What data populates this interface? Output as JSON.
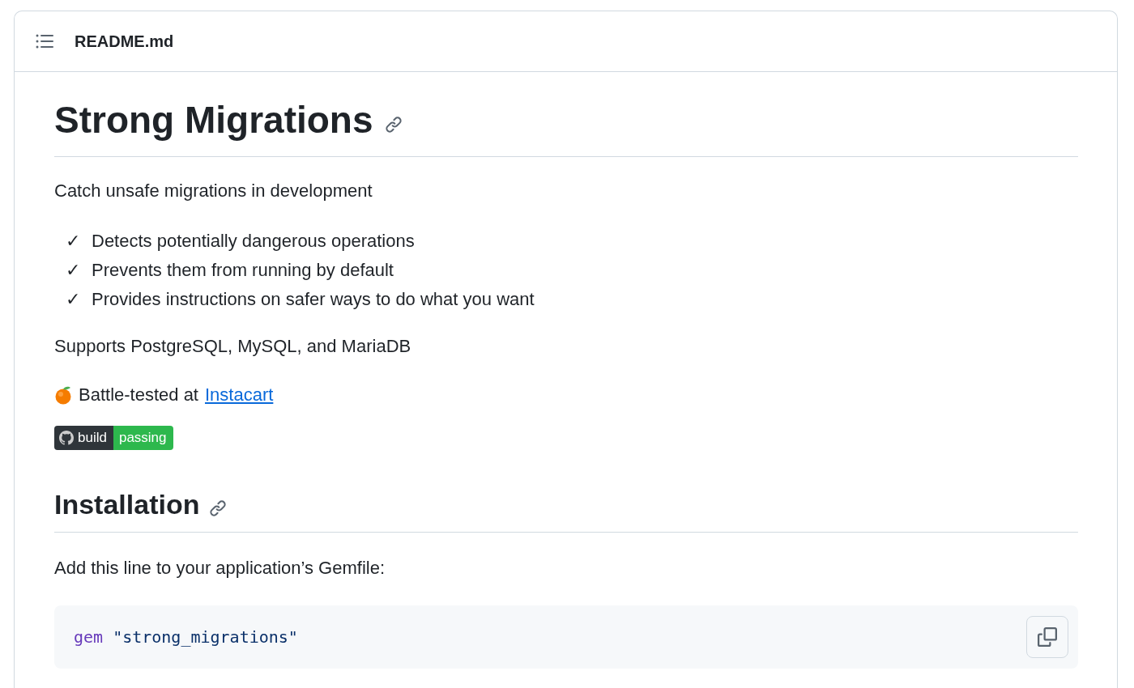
{
  "header": {
    "title": "README.md"
  },
  "title": "Strong Migrations",
  "tagline": "Catch unsafe migrations in development",
  "features": [
    {
      "mark": "✓",
      "text": "Detects potentially dangerous operations"
    },
    {
      "mark": "✓",
      "text": "Prevents them from running by default"
    },
    {
      "mark": "✓",
      "text": "Provides instructions on safer ways to do what you want"
    }
  ],
  "supports": "Supports PostgreSQL, MySQL, and MariaDB",
  "battle_tested": {
    "text": "Battle-tested at",
    "link": "Instacart"
  },
  "badge": {
    "label": "build",
    "status": "passing"
  },
  "installation": {
    "heading": "Installation",
    "intro": "Add this line to your application’s Gemfile:",
    "code": {
      "keyword": "gem",
      "string": "\"strong_migrations\""
    }
  }
}
